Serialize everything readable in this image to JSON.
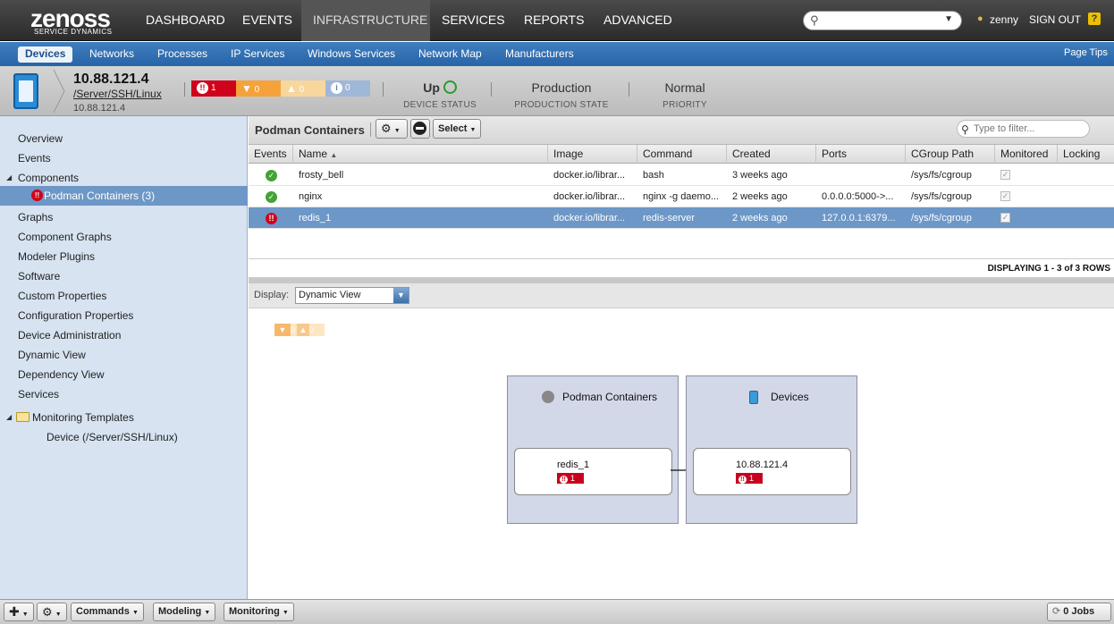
{
  "app": {
    "brand": "zenoss",
    "tagline": "SERVICE DYNAMICS"
  },
  "nav": {
    "items": [
      "DASHBOARD",
      "EVENTS",
      "INFRASTRUCTURE",
      "SERVICES",
      "REPORTS",
      "ADVANCED"
    ],
    "active": "INFRASTRUCTURE",
    "user": "zenny",
    "signout": "SIGN OUT",
    "help": "?"
  },
  "subnav": {
    "items": [
      "Devices",
      "Networks",
      "Processes",
      "IP Services",
      "Windows Services",
      "Network Map",
      "Manufacturers"
    ],
    "active": "Devices",
    "page_tips": "Page Tips"
  },
  "device": {
    "name": "10.88.121.4",
    "path": "/Server/SSH/Linux",
    "ip": "10.88.121.4",
    "events": {
      "critical": "1",
      "error": "0",
      "warning": "0",
      "info": "0"
    },
    "status_value": "Up",
    "status_label": "DEVICE STATUS",
    "prod_state": "Production",
    "prod_label": "PRODUCTION STATE",
    "priority": "Normal",
    "priority_label": "PRIORITY"
  },
  "leftnav": {
    "overview": "Overview",
    "events": "Events",
    "components": "Components",
    "podman": "Podman Containers (3)",
    "graphs": "Graphs",
    "component_graphs": "Component Graphs",
    "modeler_plugins": "Modeler Plugins",
    "software": "Software",
    "custom_props": "Custom Properties",
    "config_props": "Configuration Properties",
    "device_admin": "Device Administration",
    "dynamic_view": "Dynamic View",
    "dependency_view": "Dependency View",
    "services": "Services",
    "monitoring_templates": "Monitoring Templates",
    "device_template": "Device (/Server/SSH/Linux)"
  },
  "panel": {
    "title": "Podman Containers",
    "select_label": "Select",
    "filter_placeholder": "Type to filter..."
  },
  "grid": {
    "columns": [
      "Events",
      "Name",
      "Image",
      "Command",
      "Created",
      "Ports",
      "CGroup Path",
      "Monitored",
      "Locking"
    ],
    "sort_indicator": "▲",
    "rows": [
      {
        "status": "ok",
        "name": "frosty_bell",
        "image": "docker.io/librar...",
        "command": "bash",
        "created": "3 weeks ago",
        "ports": "",
        "cgroup": "/sys/fs/cgroup"
      },
      {
        "status": "ok",
        "name": "nginx",
        "image": "docker.io/librar...",
        "command": "nginx -g daemo...",
        "created": "2 weeks ago",
        "ports": "0.0.0.0:5000->...",
        "cgroup": "/sys/fs/cgroup"
      },
      {
        "status": "critical",
        "name": "redis_1",
        "image": "docker.io/librar...",
        "command": "redis-server",
        "created": "2 weeks ago",
        "ports": "127.0.0.1:6379...",
        "cgroup": "/sys/fs/cgroup"
      }
    ],
    "pager": "DISPLAYING 1 - 3 of 3 ROWS"
  },
  "display": {
    "label": "Display:",
    "value": "Dynamic View",
    "summary_error": "0",
    "summary_warning": "0"
  },
  "dynamic_view": {
    "left_group": "Podman Containers",
    "left_node": "redis_1",
    "left_count": "1",
    "right_group": "Devices",
    "right_node": "10.88.121.4",
    "right_count": "1"
  },
  "bottombar": {
    "commands": "Commands",
    "modeling": "Modeling",
    "monitoring": "Monitoring",
    "jobs": "0 Jobs"
  }
}
